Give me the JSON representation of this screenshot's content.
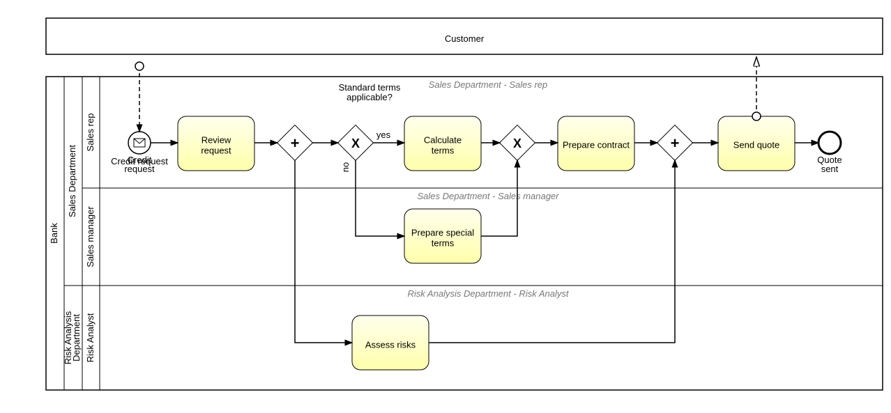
{
  "customerPool": "Customer",
  "bankPool": "Bank",
  "lanes": {
    "salesDept": "Sales Department",
    "salesRep": "Sales rep",
    "salesMgr": "Sales manager",
    "riskDept": "Risk Analysis Department",
    "riskAnalyst": "Risk Analyst"
  },
  "startEvent": "Credit request",
  "tasks": {
    "review": "Review request",
    "calc": "Calculate terms",
    "special": "Prepare special terms",
    "contract": "Prepare contract",
    "send": "Send quote",
    "assess": "Assess risks"
  },
  "gatewayQuestion1": "Standard terms",
  "gatewayQuestion2": "applicable?",
  "yes": "yes",
  "no": "no",
  "endEvent1": "Quote",
  "endEvent2": "sent",
  "watermarks": {
    "rep": "Sales Department - Sales rep",
    "mgr": "Sales Department - Sales manager",
    "risk": "Risk Analysis Department - Risk Analyst"
  }
}
